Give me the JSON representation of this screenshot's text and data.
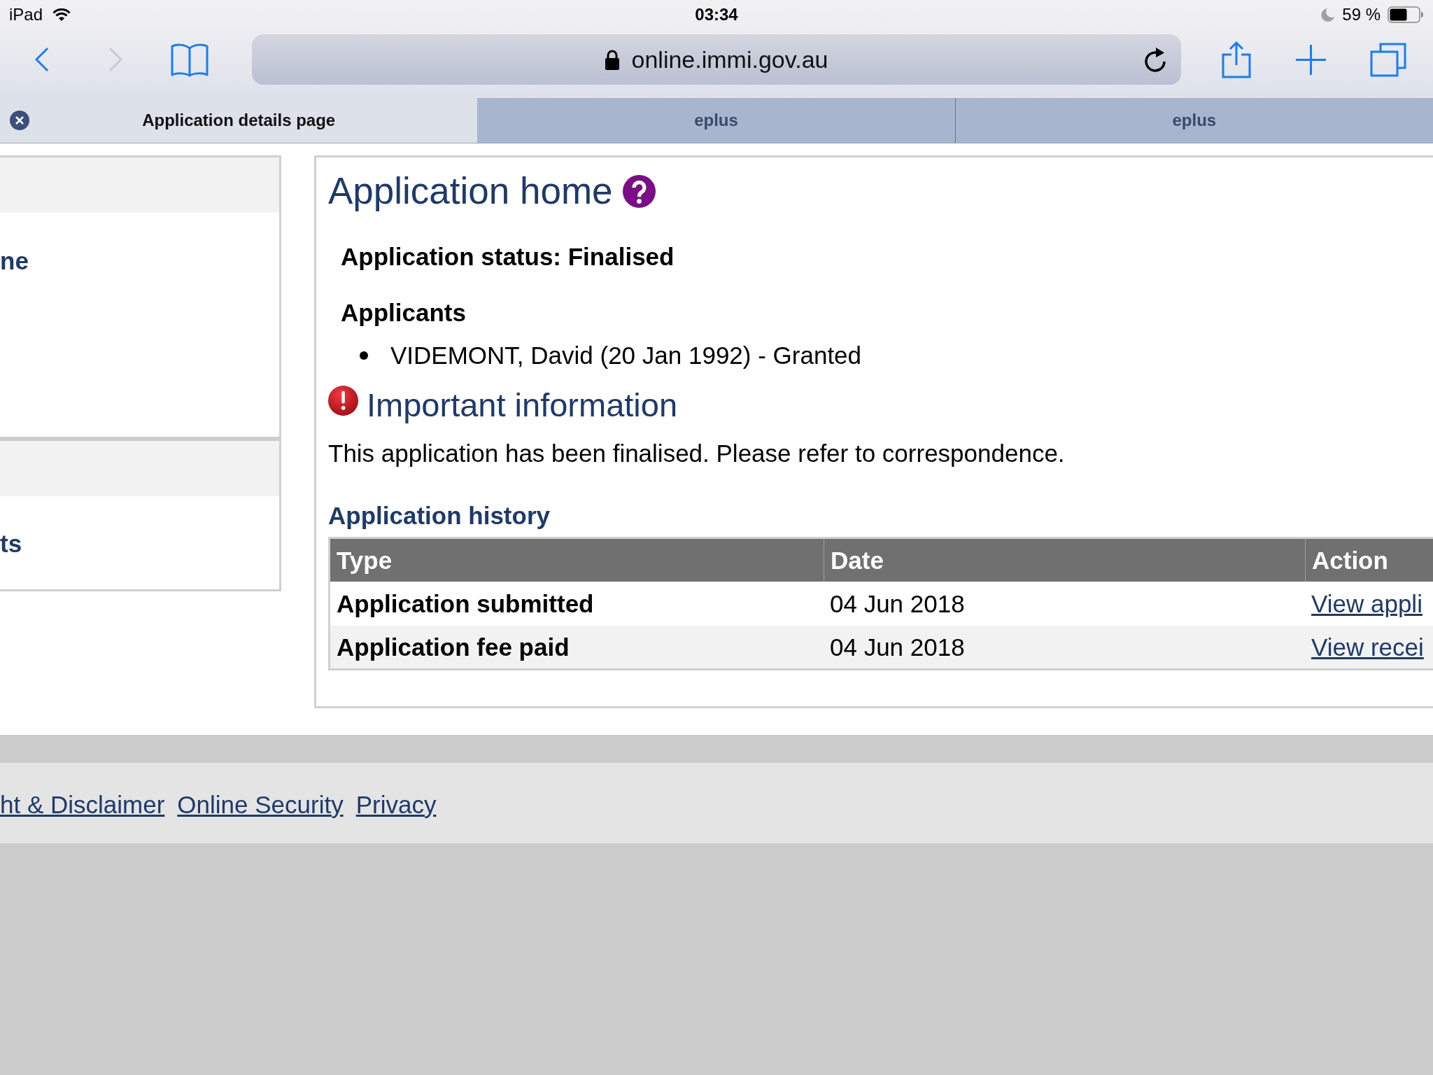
{
  "status_bar": {
    "device": "iPad",
    "time": "03:34",
    "battery": "59 %"
  },
  "toolbar": {
    "back_enabled": true,
    "forward_enabled": false,
    "url": "online.immi.gov.au"
  },
  "tabs": [
    {
      "label": "Application details page",
      "selected": true
    },
    {
      "label": "eplus",
      "selected": false
    },
    {
      "label": "eplus",
      "selected": false
    }
  ],
  "sidebar": {
    "links": [
      "ne",
      "ts"
    ]
  },
  "main": {
    "title": "Application home",
    "status": "Application status: Finalised",
    "applicants_heading": "Applicants",
    "applicants": [
      "VIDEMONT, David (20 Jan 1992) - Granted"
    ],
    "notice": {
      "title": "Important information",
      "text": "This application has been finalised. Please refer to correspondence."
    },
    "history": {
      "title": "Application history",
      "columns": [
        "Type",
        "Date",
        "Action"
      ],
      "rows": [
        {
          "type": "Application submitted",
          "date": "04 Jun 2018",
          "action": "View appli"
        },
        {
          "type": "Application fee paid",
          "date": "04 Jun 2018",
          "action": "View recei"
        }
      ]
    }
  },
  "footer": {
    "links": [
      "ht & Disclaimer",
      "Online Security",
      "Privacy"
    ]
  }
}
